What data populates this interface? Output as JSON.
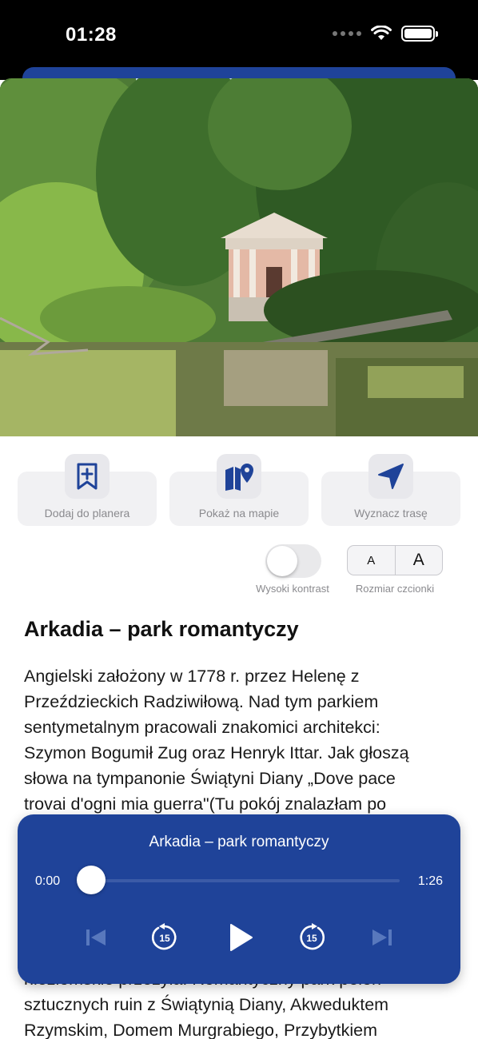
{
  "status_bar": {
    "time": "01:28"
  },
  "gallery": {
    "page_count": 3,
    "active_page": 1
  },
  "actions": [
    {
      "label": "Dodaj do planera",
      "icon": "bookmark-plus-icon"
    },
    {
      "label": "Pokaż na mapie",
      "icon": "map-pin-icon"
    },
    {
      "label": "Wyznacz trasę",
      "icon": "navigation-arrow-icon"
    }
  ],
  "settings": {
    "high_contrast_label": "Wysoki kontrast",
    "high_contrast_on": false,
    "font_small": "A",
    "font_large": "A",
    "font_size_label": "Rozmiar czcionki"
  },
  "article": {
    "title": "Arkadia – park romantyczy",
    "body_top": "Angielski założony w 1778 r. przez Helenę z\nPrzeździeckich  Radziwiłową. Nad tym parkiem\nsentymetalnym  pracowali znakomici architekci:\nSzymon Bogumił Zug oraz Henryk Ittar. Jak głoszą\nsłowa na tympanonie Świątyni Diany  „Dove pace\ntrovai d'ogni mia guerra\"(Tu pokój znalazłam po",
    "body_bottom": "niezłomskie przeżyła. Romantyczny park pełen\nsztucznych  ruin z Świątynią Diany, Akweduktem\nRzymskim, Domem Murgrabiego, Przybytkiem"
  },
  "player": {
    "title": "Arkadia – park romantyczy",
    "current_time": "0:00",
    "duration": "1:26",
    "progress": 0,
    "rewind_seconds": "15",
    "forward_seconds": "15"
  },
  "colors": {
    "brand_blue": "#1f4399",
    "icon_blue": "#1f4399"
  }
}
